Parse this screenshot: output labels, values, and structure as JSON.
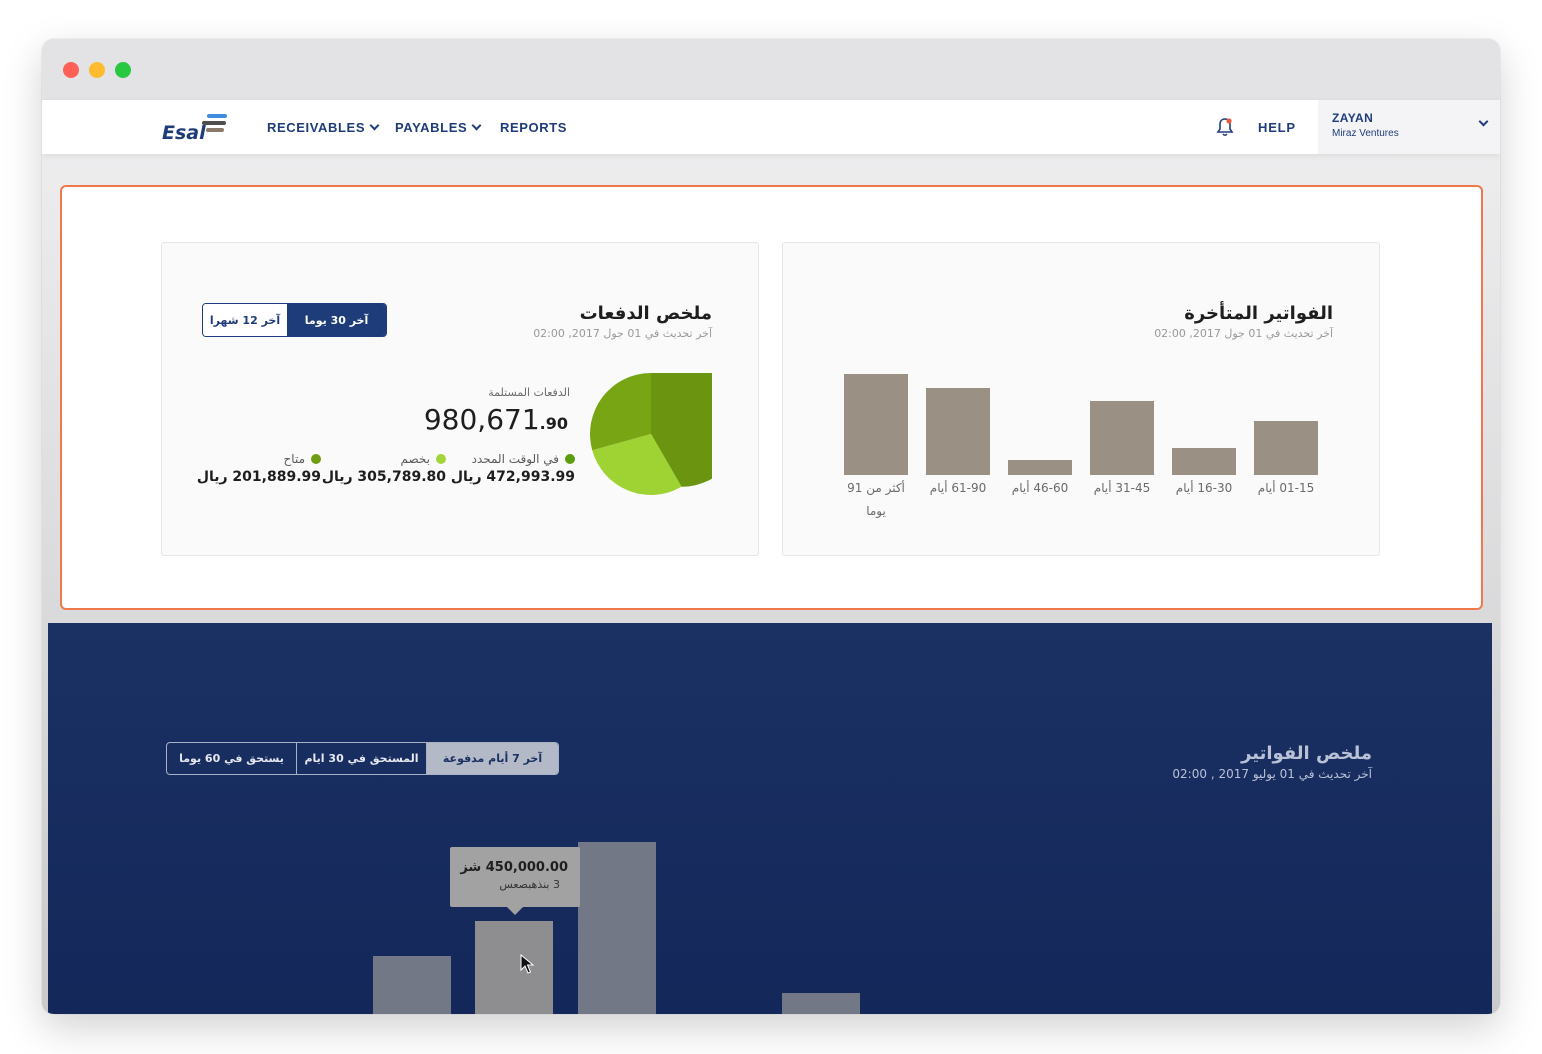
{
  "brand": {
    "name": "Esal",
    "accent": "#1f3c7a",
    "logo_bars": [
      "#3e8ee0",
      "#4f4f4f",
      "#8a7a6a"
    ]
  },
  "nav": {
    "items": [
      {
        "label": "RECEIVABLES",
        "dropdown": true
      },
      {
        "label": "PAYABLES",
        "dropdown": true
      },
      {
        "label": "REPORTS",
        "dropdown": false
      }
    ],
    "bell_icon": "bell-icon",
    "help": "HELP",
    "user": {
      "name": "ZAYAN",
      "company": "Miraz Ventures"
    }
  },
  "payments": {
    "title": "ملخص الدفعات",
    "updated": "آخر تحديث في 01 جول 2017, 02:00",
    "toggle": {
      "active": "آخر 30 يوما",
      "inactive": "آخر 12 شهرا"
    },
    "received_label": "الدفعات المستلمة",
    "received_int": "980,671",
    "received_dec": ".90",
    "legend": [
      {
        "label": "في الوقت المحدد",
        "value": "472,993.99 ريال",
        "color": "#5a9e0d"
      },
      {
        "label": "بخصم",
        "value": "305,789.80 ريال",
        "color": "#a5d43a"
      },
      {
        "label": "متاح",
        "value": "201,889.99 ريال",
        "color": "#6e9d11"
      }
    ],
    "pie_colors": [
      "#6b9410",
      "#9fd233",
      "#78a514"
    ]
  },
  "overdue": {
    "title": "الفواتير المتأخرة",
    "updated": "آخر تحديث في 01 جول 2017, 02:00",
    "bar_color": "#9b9084",
    "categories": [
      "01-15 أيام",
      "16-30 أيام",
      "31-45 أيام",
      "46-60 أيام",
      "61-90 أيام",
      "أكثر من 91 يوما"
    ],
    "values": [
      0.53,
      0.27,
      0.73,
      0.15,
      0.86,
      1.0
    ]
  },
  "invoices": {
    "title": "ملخص الفواتير",
    "updated": "آخر تحديث في 01 يوليو 2017 , 02:00",
    "tabs": [
      "آخر 7 أيام مدفوعة",
      "المستحق في 30 ايام",
      "يستحق في 60 يوما"
    ],
    "tooltip": {
      "amount": "450,000.00 شز",
      "count": "3 بنذهبصعس"
    },
    "bar_values": [
      0.34,
      0.54,
      1.0,
      0.12
    ]
  },
  "colors": {
    "highlight_border": "#ee7a4c",
    "blue_bg": "#1b3163"
  }
}
